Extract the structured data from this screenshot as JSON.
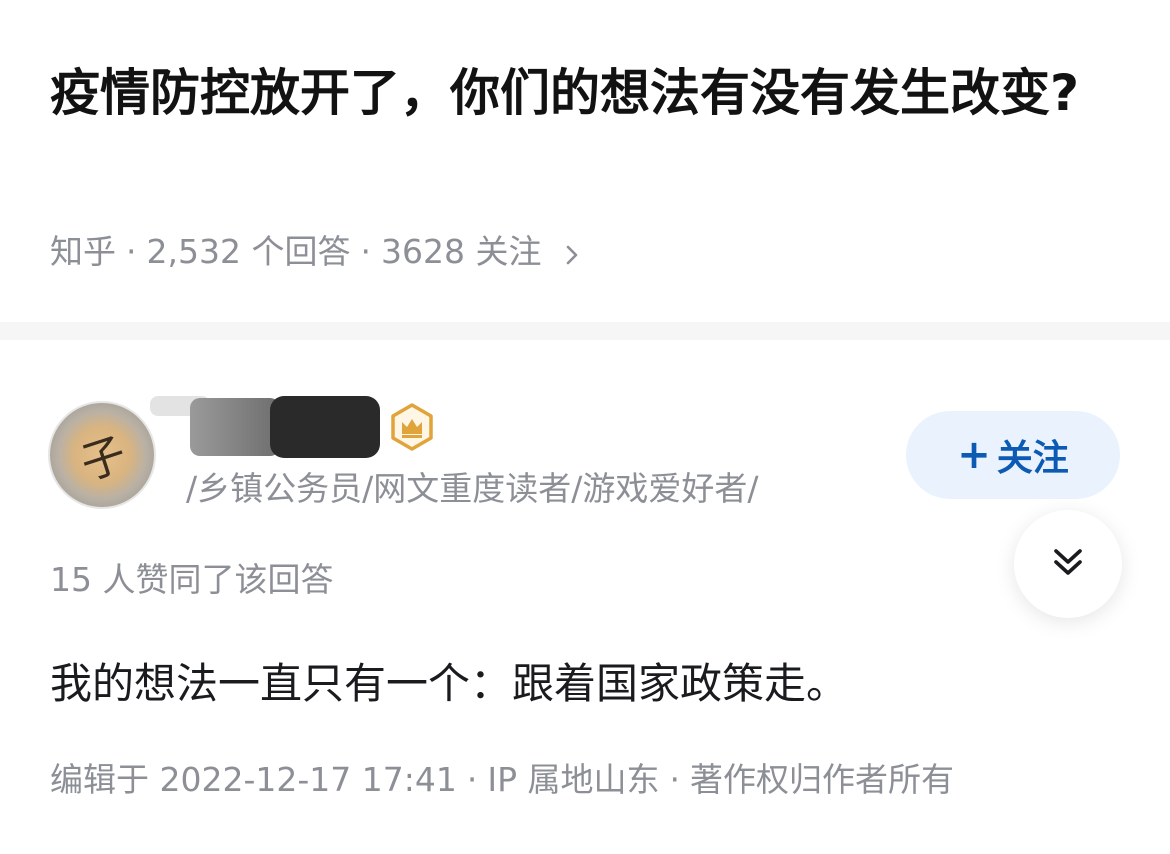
{
  "question": {
    "title": "疫情防控放开了，你们的想法有没有发生改变?",
    "source": "知乎",
    "answer_count": "2,532 个回答",
    "follower_count": "3628 关注",
    "separator": "·",
    "chevron_icon": "chevron-right-icon"
  },
  "answer": {
    "author": {
      "avatar_glyph": "子",
      "badge_icon": "crown-badge-icon",
      "badge_color": "#e0a43b",
      "bio": "/乡镇公务员/网文重度读者/游戏爱好者/"
    },
    "follow_button": {
      "plus": "+",
      "label": "关注"
    },
    "expand_icon": "double-chevron-down-icon",
    "votes": "15 人赞同了该回答",
    "content": "我的想法一直只有一个：跟着国家政策走。",
    "footer": {
      "edited": "编辑于 2022-12-17 17:41",
      "ip": "IP 属地山东",
      "copyright": "著作权归作者所有",
      "separator": "·"
    }
  },
  "colors": {
    "accent": "#0c5ab3",
    "follow_bg": "#eaf3fd",
    "meta_text": "#8c8f96",
    "divider": "#f6f6f6"
  }
}
